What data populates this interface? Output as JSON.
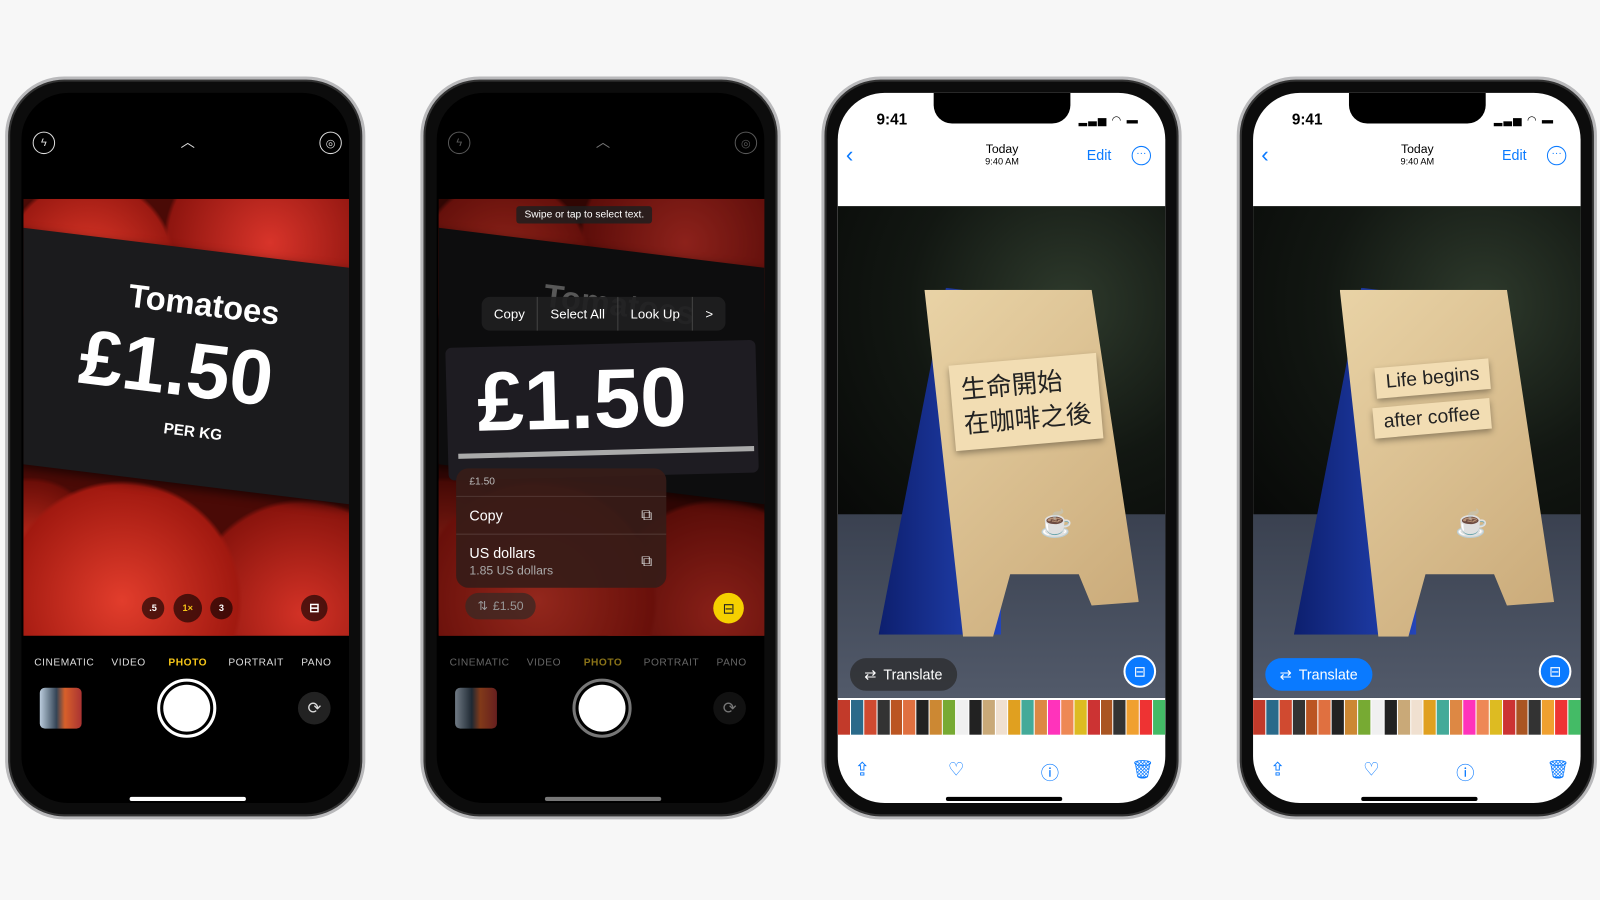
{
  "camera": {
    "top_icons": [
      "flash-icon",
      "chevron-up-icon",
      "live-photo-icon"
    ],
    "sign_title": "Tomatoes",
    "sign_price": "£1.50",
    "sign_unit": "PER KG",
    "zoom_levels": [
      ".5",
      "1×",
      "3"
    ],
    "modes": [
      "CINEMATIC",
      "VIDEO",
      "PHOTO",
      "PORTRAIT",
      "PANO"
    ],
    "active_mode": "PHOTO",
    "accent": "#f5c518"
  },
  "livetext": {
    "hint": "Swipe or tap to select text.",
    "menu": [
      "Copy",
      "Select All",
      "Look Up",
      ">"
    ],
    "selected_text": "£1.50",
    "card_header": "£1.50",
    "copy_label": "Copy",
    "convert_label": "US dollars",
    "convert_value": "1.85 US dollars",
    "chip_label": "£1.50"
  },
  "photos_original": {
    "time": "9:41",
    "title": "Today",
    "subtitle": "9:40 AM",
    "edit": "Edit",
    "sign_line1": "生命開始",
    "sign_line2": "在咖啡之後",
    "translate": "Translate"
  },
  "photos_translated": {
    "time": "9:41",
    "title": "Today",
    "subtitle": "9:40 AM",
    "edit": "Edit",
    "sign_line1": "Life begins",
    "sign_line2": "after coffee",
    "translate": "Translate"
  },
  "toolbar_icons": [
    "share-icon",
    "heart-icon",
    "info-icon",
    "trash-icon"
  ],
  "thumb_colors": [
    "#c23a2a",
    "#2a6a8a",
    "#d04a30",
    "#333",
    "#b52",
    "#e07040",
    "#222",
    "#c83",
    "#7a3",
    "#f0f0f0",
    "#222",
    "#c9a978",
    "#f0e0d0",
    "#e0a020",
    "#4a9",
    "#d84",
    "#f3b",
    "#e85",
    "#db2",
    "#c33",
    "#a52",
    "#333",
    "#f0a030",
    "#e33",
    "#4b6"
  ],
  "colors": {
    "ios_blue": "#0a7aff",
    "livetext_yellow": "#f5d000"
  }
}
